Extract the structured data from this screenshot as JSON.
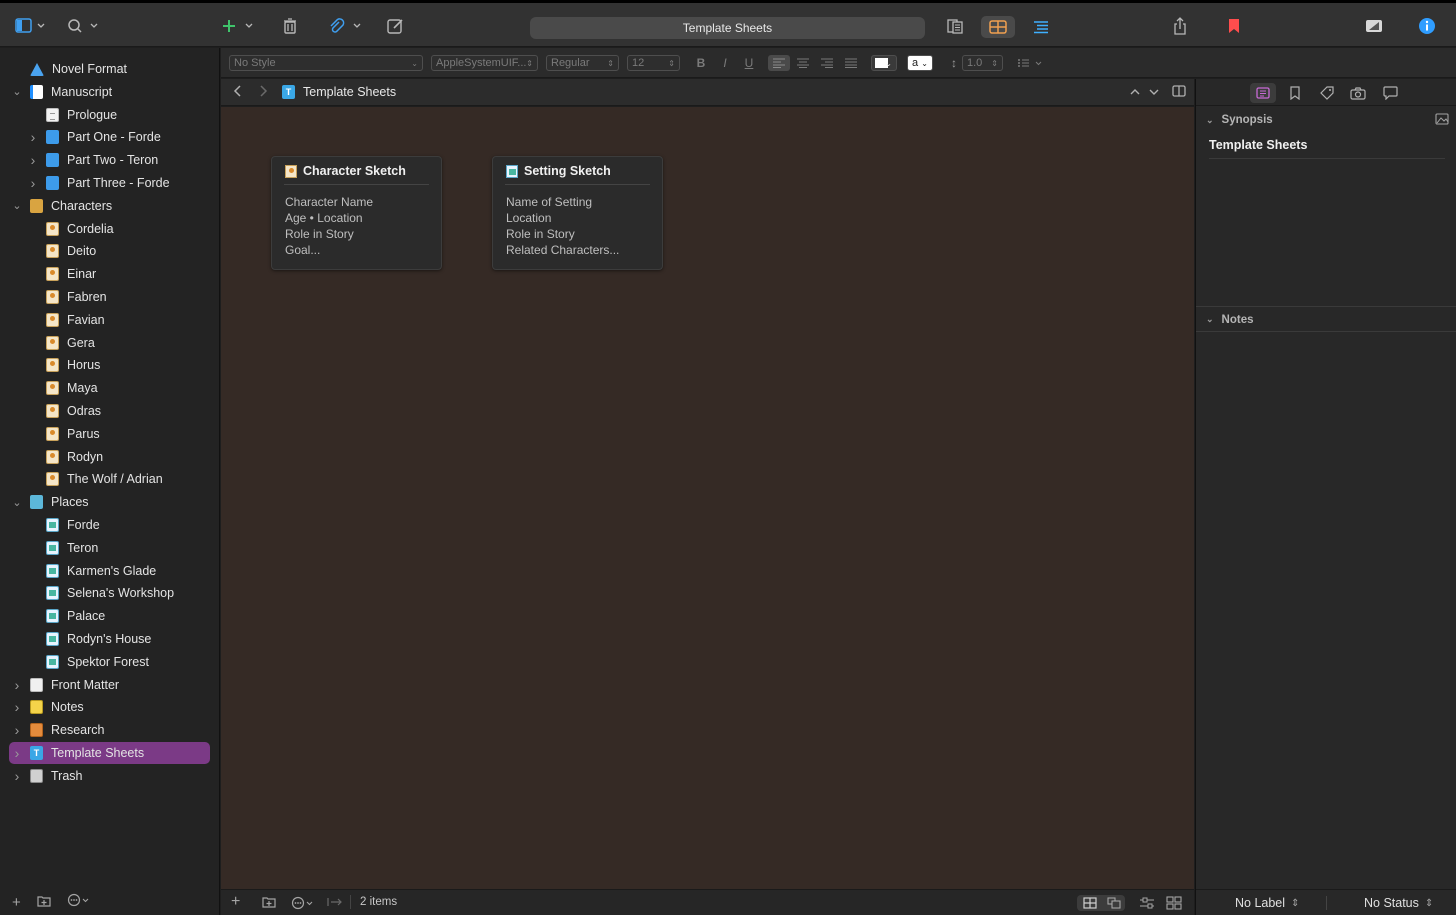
{
  "toolbar": {
    "document_title": "Template Sheets",
    "icons": [
      "sidebar-toggle-icon",
      "search-icon",
      "add-icon",
      "trash-icon",
      "attachment-icon",
      "compose-icon",
      "scrivenings-icon",
      "corkboard-icon",
      "outline-icon",
      "share-icon",
      "bookmark-icon",
      "quick-reference-icon",
      "inspector-icon"
    ],
    "accent_colors": {
      "add": "#3fc46b",
      "attachment": "#3f9ff0",
      "corkboard": "#f0a050",
      "outline": "#3fb0ff",
      "bookmark": "#ff4d4d",
      "inspector": "#2f9dff"
    }
  },
  "format_bar": {
    "style": "No Style",
    "font": "AppleSystemUIF...",
    "weight": "Regular",
    "size": "12",
    "bold": "B",
    "italic": "I",
    "underline": "U",
    "highlight_letter": "a",
    "line_spacing": "1.0"
  },
  "binder": {
    "items": [
      {
        "label": "Novel Format",
        "depth": 0,
        "expander": "",
        "icon": "novel"
      },
      {
        "label": "Manuscript",
        "depth": 0,
        "expander": "open",
        "icon": "manu"
      },
      {
        "label": "Prologue",
        "depth": 1,
        "expander": "",
        "icon": "doc"
      },
      {
        "label": "Part One - Forde",
        "depth": 1,
        "expander": "closed",
        "icon": "folder"
      },
      {
        "label": "Part Two - Teron",
        "depth": 1,
        "expander": "closed",
        "icon": "folder"
      },
      {
        "label": "Part Three - Forde",
        "depth": 1,
        "expander": "closed",
        "icon": "folder"
      },
      {
        "label": "Characters",
        "depth": 0,
        "expander": "open",
        "icon": "charfolder"
      },
      {
        "label": "Cordelia",
        "depth": 1,
        "expander": "",
        "icon": "char"
      },
      {
        "label": "Deito",
        "depth": 1,
        "expander": "",
        "icon": "char"
      },
      {
        "label": "Einar",
        "depth": 1,
        "expander": "",
        "icon": "char"
      },
      {
        "label": "Fabren",
        "depth": 1,
        "expander": "",
        "icon": "char"
      },
      {
        "label": "Favian",
        "depth": 1,
        "expander": "",
        "icon": "char"
      },
      {
        "label": "Gera",
        "depth": 1,
        "expander": "",
        "icon": "char"
      },
      {
        "label": "Horus",
        "depth": 1,
        "expander": "",
        "icon": "char"
      },
      {
        "label": "Maya",
        "depth": 1,
        "expander": "",
        "icon": "char"
      },
      {
        "label": "Odras",
        "depth": 1,
        "expander": "",
        "icon": "char"
      },
      {
        "label": "Parus",
        "depth": 1,
        "expander": "",
        "icon": "char"
      },
      {
        "label": "Rodyn",
        "depth": 1,
        "expander": "",
        "icon": "char"
      },
      {
        "label": "The Wolf / Adrian",
        "depth": 1,
        "expander": "",
        "icon": "char"
      },
      {
        "label": "Places",
        "depth": 0,
        "expander": "open",
        "icon": "placefolder"
      },
      {
        "label": "Forde",
        "depth": 1,
        "expander": "",
        "icon": "place"
      },
      {
        "label": "Teron",
        "depth": 1,
        "expander": "",
        "icon": "place"
      },
      {
        "label": "Karmen's Glade",
        "depth": 1,
        "expander": "",
        "icon": "place"
      },
      {
        "label": "Selena's Workshop",
        "depth": 1,
        "expander": "",
        "icon": "place"
      },
      {
        "label": "Palace",
        "depth": 1,
        "expander": "",
        "icon": "place"
      },
      {
        "label": "Rodyn's House",
        "depth": 1,
        "expander": "",
        "icon": "place"
      },
      {
        "label": "Spektor Forest",
        "depth": 1,
        "expander": "",
        "icon": "place"
      },
      {
        "label": "Front Matter",
        "depth": 0,
        "expander": "closed",
        "icon": "front"
      },
      {
        "label": "Notes",
        "depth": 0,
        "expander": "closed",
        "icon": "notes"
      },
      {
        "label": "Research",
        "depth": 0,
        "expander": "closed",
        "icon": "research"
      },
      {
        "label": "Template Sheets",
        "depth": 0,
        "expander": "closed",
        "icon": "template",
        "selected": true
      },
      {
        "label": "Trash",
        "depth": 0,
        "expander": "closed",
        "icon": "trash"
      }
    ],
    "selection_color": "#7b3a86"
  },
  "editor": {
    "header_title": "Template Sheets",
    "cards": [
      {
        "title": "Character Sketch",
        "lines": [
          "Character Name",
          "Age • Location",
          "Role in Story",
          "Goal..."
        ]
      },
      {
        "title": "Setting Sketch",
        "lines": [
          "Name of Setting",
          "Location",
          "Role in Story",
          "Related Characters..."
        ]
      }
    ],
    "corkboard_color": "#352a25",
    "item_count": "2 items"
  },
  "inspector": {
    "synopsis_label": "Synopsis",
    "synopsis_title": "Template Sheets",
    "notes_label": "Notes",
    "label_value": "No Label",
    "status_value": "No Status"
  }
}
